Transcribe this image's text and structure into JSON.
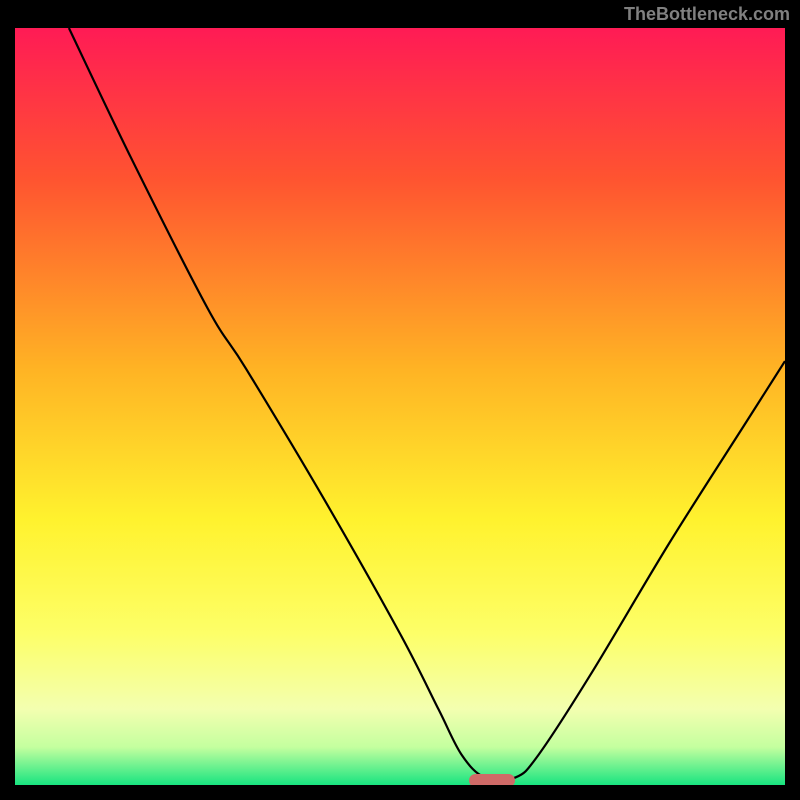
{
  "watermark": "TheBottleneck.com",
  "chart_data": {
    "type": "line",
    "title": "",
    "xlabel": "",
    "ylabel": "",
    "x_range": [
      0,
      100
    ],
    "y_range": [
      0,
      100
    ],
    "series": [
      {
        "name": "curve",
        "x": [
          7,
          15,
          25,
          30,
          40,
          50,
          55,
          58,
          61,
          65,
          68,
          75,
          85,
          95,
          100
        ],
        "y": [
          100,
          83,
          63,
          55,
          38,
          20,
          10,
          4,
          1,
          1,
          4,
          15,
          32,
          48,
          56
        ]
      }
    ],
    "marker": {
      "x_center": 62,
      "y": 0.5,
      "width_pct": 6
    },
    "gradient_stops": [
      {
        "pct": 0,
        "color": "#ff1b55"
      },
      {
        "pct": 20,
        "color": "#ff5430"
      },
      {
        "pct": 45,
        "color": "#ffb324"
      },
      {
        "pct": 65,
        "color": "#fff22e"
      },
      {
        "pct": 80,
        "color": "#fdff68"
      },
      {
        "pct": 90,
        "color": "#f3ffb0"
      },
      {
        "pct": 95,
        "color": "#c4ff9f"
      },
      {
        "pct": 100,
        "color": "#18e480"
      }
    ]
  }
}
